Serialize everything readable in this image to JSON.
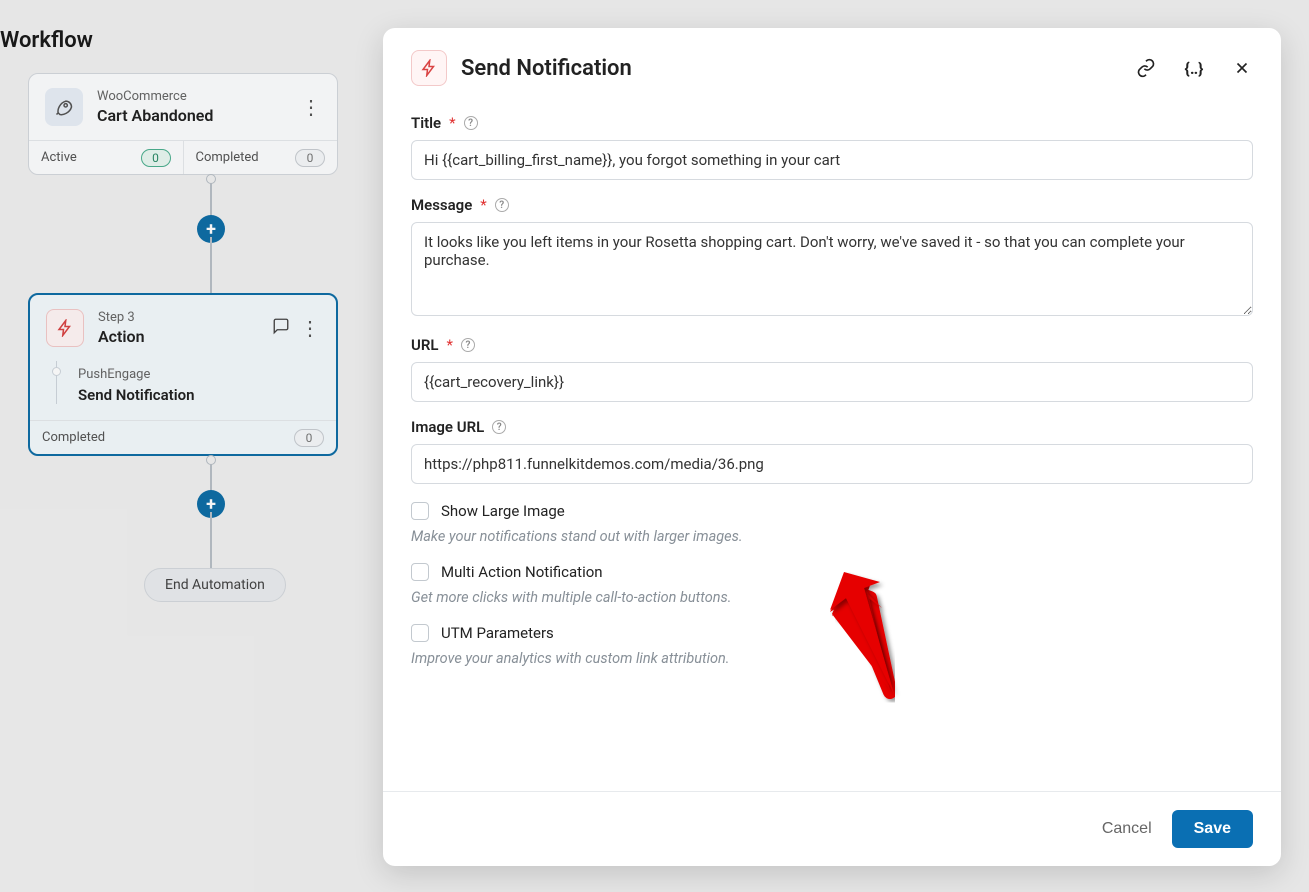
{
  "page_title": "Workflow",
  "trigger_node": {
    "source": "WooCommerce",
    "title": "Cart Abandoned",
    "active_label": "Active",
    "active_count": "0",
    "completed_label": "Completed",
    "completed_count": "0"
  },
  "action_node": {
    "step": "Step 3",
    "title": "Action",
    "brand": "PushEngage",
    "action": "Send Notification",
    "completed_label": "Completed",
    "completed_count": "0"
  },
  "end_label": "End Automation",
  "modal": {
    "title": "Send Notification",
    "fields": {
      "title": {
        "label": "Title",
        "value": "Hi {{cart_billing_first_name}}, you forgot something in your cart"
      },
      "message": {
        "label": "Message",
        "value": "It looks like you left items in your Rosetta shopping cart. Don't worry, we've saved it - so that you can complete your purchase."
      },
      "url": {
        "label": "URL",
        "value": "{{cart_recovery_link}}"
      },
      "image": {
        "label": "Image URL",
        "value": "https://php811.funnelkitdemos.com/media/36.png"
      }
    },
    "checkboxes": {
      "large_image": {
        "label": "Show Large Image",
        "desc": "Make your notifications stand out with larger images."
      },
      "multi_action": {
        "label": "Multi Action Notification",
        "desc": "Get more clicks with multiple call-to-action buttons."
      },
      "utm": {
        "label": "UTM Parameters",
        "desc": "Improve your analytics with custom link attribution."
      }
    },
    "buttons": {
      "cancel": "Cancel",
      "save": "Save"
    }
  }
}
